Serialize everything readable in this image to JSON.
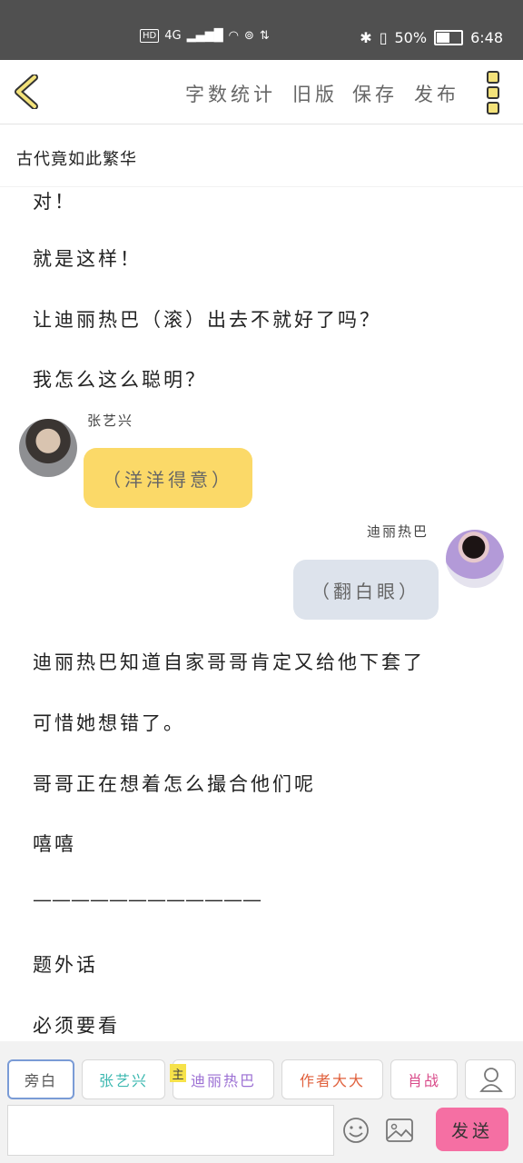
{
  "status_bar": {
    "hd": "HD",
    "network": "4G",
    "battery": "50%",
    "battery_level": 0.5,
    "time": "6:48"
  },
  "header": {
    "menu": [
      "字数统计",
      "旧版",
      "保存",
      "发布"
    ],
    "icons": [
      "back-chevron-icon",
      "more-icon"
    ]
  },
  "story": {
    "title": "古代竟如此繁华"
  },
  "content": {
    "paragraphs_top": [
      "对！",
      "就是这样！",
      "让迪丽热巴（滚）出去不就好了吗？",
      "我怎么这么聪明？"
    ],
    "messages": [
      {
        "speaker": "张艺兴",
        "text": "（洋洋得意）",
        "side": "left",
        "bubble_color": "#fbd968"
      },
      {
        "speaker": "迪丽热巴",
        "text": "（翻白眼）",
        "side": "right",
        "bubble_color": "#dde3ec"
      }
    ],
    "paragraphs_bottom": [
      "迪丽热巴知道自家哥哥肯定又给他下套了",
      "可惜她想错了。",
      "哥哥正在想着怎么撮合他们呢",
      "嘻嘻",
      "————————————",
      "题外话",
      "必须要看"
    ]
  },
  "bottom_bar": {
    "roles": [
      {
        "label": "旁白",
        "color": "#555555",
        "active": true
      },
      {
        "label": "张艺兴",
        "color": "#3cb8b0",
        "active": false
      },
      {
        "label": "迪丽热巴",
        "color": "#9b6fd3",
        "active": false
      },
      {
        "label": "作者大大",
        "color": "#e0603c",
        "active": false
      },
      {
        "label": "肖战",
        "color": "#d94b8a",
        "active": false
      }
    ],
    "main_badge": "主",
    "input_value": "",
    "input_placeholder": "",
    "send_label": "发送",
    "accent_color": "#f56fa3"
  }
}
